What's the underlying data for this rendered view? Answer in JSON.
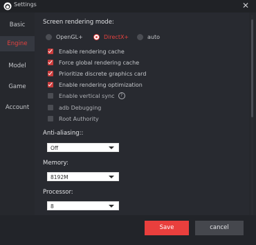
{
  "window": {
    "title": "Settings"
  },
  "icons": {
    "app": "app-logo-icon",
    "close": "close-icon",
    "help": "question-icon",
    "dropdown": "chevron-down-icon"
  },
  "colors": {
    "accent": "#e4423f",
    "save_button": "#e93f3d",
    "checkbox_checked": "#ca3c3c",
    "background": "#26282d"
  },
  "sidebar": {
    "items": [
      {
        "label": "Basic",
        "active": false
      },
      {
        "label": "Engine",
        "active": true
      },
      {
        "label": "Model",
        "active": false
      },
      {
        "label": "Game",
        "active": false
      },
      {
        "label": "Account",
        "active": false
      }
    ]
  },
  "engine": {
    "rendering_mode_title": "Screen rendering mode:",
    "rendering_modes": [
      {
        "label": "OpenGL+",
        "selected": false
      },
      {
        "label": "DirectX+",
        "selected": true
      },
      {
        "label": "auto",
        "selected": false
      }
    ],
    "options": [
      {
        "label": "Enable rendering cache",
        "checked": true
      },
      {
        "label": "Force global rendering cache",
        "checked": true
      },
      {
        "label": "Prioritize discrete graphics card",
        "checked": true
      },
      {
        "label": "Enable rendering optimization",
        "checked": true
      },
      {
        "label": "Enable vertical sync",
        "checked": false,
        "help": "?"
      },
      {
        "label": "adb Debugging",
        "checked": false
      },
      {
        "label": "Root Authority",
        "checked": false
      }
    ],
    "anti_aliasing": {
      "title": "Anti-aliasing::",
      "value": "Off"
    },
    "memory": {
      "title": "Memory:",
      "value": "8192M"
    },
    "processor": {
      "title": "Processor:",
      "value": "8"
    }
  },
  "footer": {
    "save_label": "Save",
    "cancel_label": "cancel"
  }
}
